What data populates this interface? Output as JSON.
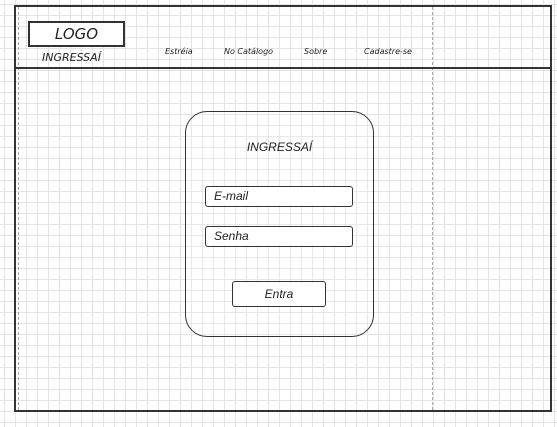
{
  "header": {
    "logo": "LOGO",
    "brand": "INGRESSAÍ",
    "nav": [
      {
        "label": "Estréia"
      },
      {
        "label": "No Catálogo"
      },
      {
        "label": "Sobre"
      },
      {
        "label": "Cadastre-se"
      }
    ]
  },
  "login": {
    "title": "INGRESSAÍ",
    "email_placeholder": "E-mail",
    "password_placeholder": "Senha",
    "submit_label": "Entra"
  }
}
